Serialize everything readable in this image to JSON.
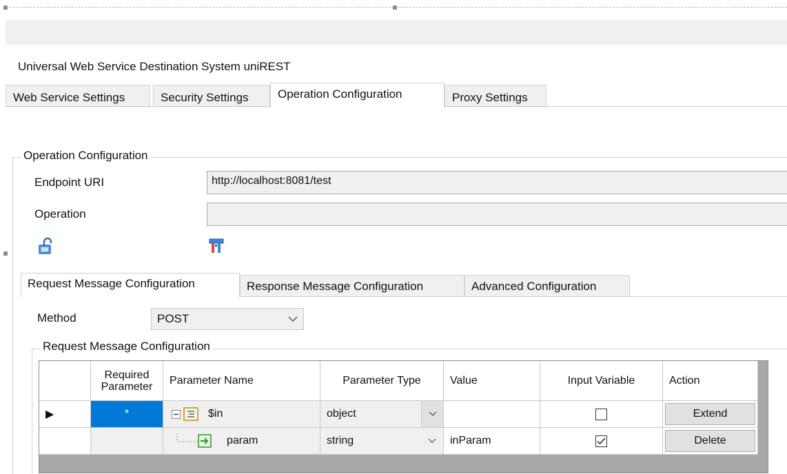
{
  "window_title": "Universal Web Service Destination System uniREST",
  "tabs": [
    {
      "label": "Web Service Settings"
    },
    {
      "label": "Security Settings"
    },
    {
      "label": "Operation Configuration",
      "active": true
    },
    {
      "label": "Proxy Settings"
    }
  ],
  "operation_group": {
    "legend": "Operation Configuration",
    "endpoint_label": "Endpoint URI",
    "endpoint_value": "http://localhost:8081/test",
    "operation_label": "Operation",
    "operation_value": "",
    "icons": [
      "unlock-icon",
      "plug-icon"
    ]
  },
  "sub_tabs": [
    {
      "label": "Request Message Configuration",
      "active": true
    },
    {
      "label": "Response Message Configuration"
    },
    {
      "label": "Advanced Configuration"
    }
  ],
  "method": {
    "label": "Method",
    "value": "POST"
  },
  "request_group": {
    "legend": "Request Message Configuration"
  },
  "grid": {
    "columns": [
      "",
      "Required Parameter",
      "Parameter Name",
      "Parameter Type",
      "Value",
      "Input Variable",
      "Action"
    ],
    "rows": [
      {
        "indicator": "▶",
        "required": "*",
        "name": "$in",
        "type": "object",
        "value": "",
        "input_variable": false,
        "action": "Extend"
      },
      {
        "indicator": "",
        "required": "",
        "name": "param",
        "type": "string",
        "value": "inParam",
        "input_variable": true,
        "action": "Delete"
      }
    ]
  },
  "colors": {
    "selection": "#0078d7",
    "tab_bg": "#f0f0f0",
    "grid_bg": "#a8a8a8"
  }
}
